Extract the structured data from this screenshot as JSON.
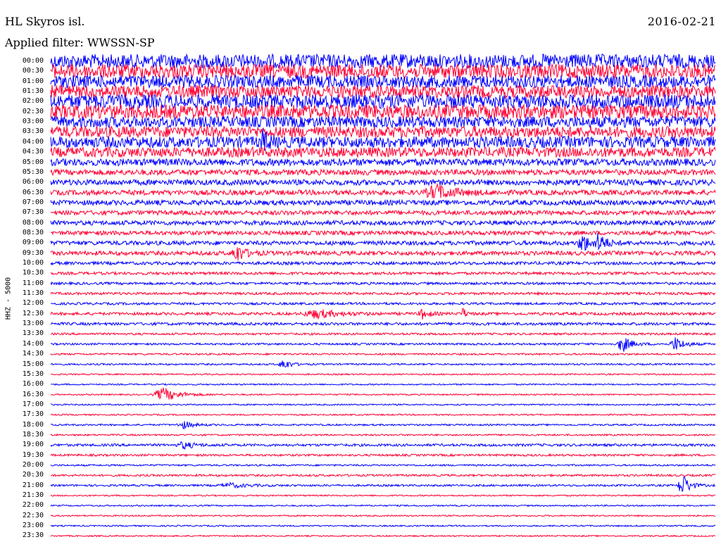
{
  "header": {
    "station": "HL Skyros isl.",
    "date": "2016-02-21",
    "filter": "Applied filter: WWSSN-SP"
  },
  "channel_label": "HHZ - 5000",
  "colors": {
    "blue": "#0000ff",
    "red": "#ff0033",
    "background": "#ffffff"
  },
  "time_labels": [
    "00:00",
    "00:30",
    "01:00",
    "01:30",
    "02:00",
    "02:30",
    "03:00",
    "03:30",
    "04:00",
    "04:30",
    "05:00",
    "05:30",
    "06:00",
    "06:30",
    "07:00",
    "07:30",
    "08:00",
    "08:30",
    "09:00",
    "09:30",
    "10:00",
    "10:30",
    "11:00",
    "11:30",
    "12:00",
    "12:30",
    "13:00",
    "13:30",
    "14:00",
    "14:30",
    "15:00",
    "15:30",
    "16:00",
    "16:30",
    "17:00",
    "17:30",
    "18:00",
    "18:30",
    "19:00",
    "19:30",
    "20:00",
    "20:30",
    "21:00",
    "21:30",
    "22:00",
    "22:30",
    "23:00",
    "23:30"
  ],
  "chart_data": {
    "type": "seismogram",
    "trace_colors": [
      "blue",
      "red"
    ],
    "noise_level_by_trace": [
      10,
      10,
      9,
      9,
      10,
      10,
      8,
      8,
      8,
      7,
      5,
      4,
      4,
      3.6,
      3.6,
      3.2,
      3.2,
      3,
      3,
      3,
      2.2,
      2,
      1.8,
      1.8,
      1.7,
      2,
      2,
      1.5,
      1.4,
      1.3,
      1.2,
      1.0,
      1.0,
      1.0,
      1.0,
      1.0,
      1.2,
      1.2,
      1.8,
      1.5,
      1.2,
      1.5,
      1.4,
      1.0,
      1.0,
      1.0,
      1.0,
      1.0
    ],
    "events": [
      {
        "trace": 8,
        "pos": 0.32,
        "amp": 14,
        "width": 0.006
      },
      {
        "trace": 13,
        "pos": 0.58,
        "amp": 10,
        "width": 0.02
      },
      {
        "trace": 18,
        "pos": 0.8,
        "amp": 14,
        "width": 0.008
      },
      {
        "trace": 18,
        "pos": 0.825,
        "amp": 14,
        "width": 0.008
      },
      {
        "trace": 19,
        "pos": 0.28,
        "amp": 12,
        "width": 0.01
      },
      {
        "trace": 25,
        "pos": 0.4,
        "amp": 6,
        "width": 0.025
      },
      {
        "trace": 25,
        "pos": 0.56,
        "amp": 7,
        "width": 0.008
      },
      {
        "trace": 25,
        "pos": 0.62,
        "amp": 8,
        "width": 0.004
      },
      {
        "trace": 28,
        "pos": 0.86,
        "amp": 12,
        "width": 0.01
      },
      {
        "trace": 28,
        "pos": 0.94,
        "amp": 10,
        "width": 0.01
      },
      {
        "trace": 30,
        "pos": 0.35,
        "amp": 8,
        "width": 0.008
      },
      {
        "trace": 33,
        "pos": 0.17,
        "amp": 10,
        "width": 0.018
      },
      {
        "trace": 36,
        "pos": 0.2,
        "amp": 5,
        "width": 0.012
      },
      {
        "trace": 38,
        "pos": 0.2,
        "amp": 5,
        "width": 0.012
      },
      {
        "trace": 42,
        "pos": 0.95,
        "amp": 18,
        "width": 0.008
      },
      {
        "trace": 42,
        "pos": 0.27,
        "amp": 3,
        "width": 0.02
      }
    ]
  }
}
